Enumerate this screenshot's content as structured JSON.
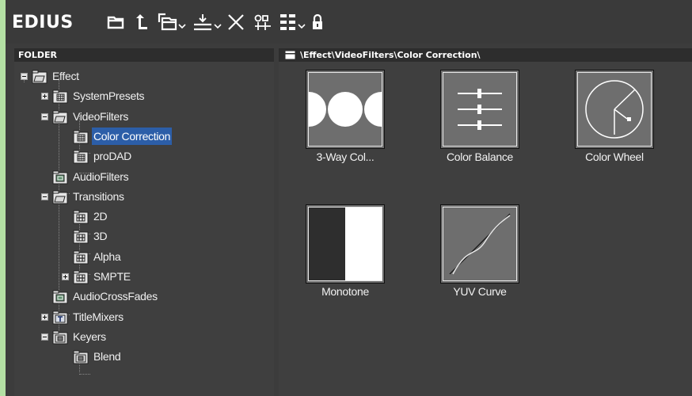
{
  "app": {
    "title": "EDIUS"
  },
  "toolbar": {
    "buttons": [
      {
        "name": "new-folder",
        "icon": "folder-icon"
      },
      {
        "name": "up-level",
        "icon": "up-arrow-icon"
      },
      {
        "name": "copy",
        "icon": "copy-icon"
      },
      {
        "name": "import",
        "icon": "import-icon"
      },
      {
        "name": "delete",
        "icon": "delete-icon"
      },
      {
        "name": "properties",
        "icon": "properties-icon"
      },
      {
        "name": "view",
        "icon": "view-list-icon"
      },
      {
        "name": "lock",
        "icon": "lock-icon"
      }
    ]
  },
  "folder_panel": {
    "title": "FOLDER",
    "tree": [
      {
        "label": "Effect",
        "expand": "minus"
      },
      {
        "label": "SystemPresets",
        "expand": "plus"
      },
      {
        "label": "VideoFilters",
        "expand": "minus"
      },
      {
        "label": "Color Correction",
        "selected": true
      },
      {
        "label": "proDAD"
      },
      {
        "label": "AudioFilters"
      },
      {
        "label": "Transitions",
        "expand": "minus"
      },
      {
        "label": "2D"
      },
      {
        "label": "3D"
      },
      {
        "label": "Alpha"
      },
      {
        "label": "SMPTE",
        "expand": "plus"
      },
      {
        "label": "AudioCrossFades"
      },
      {
        "label": "TitleMixers",
        "expand": "plus"
      },
      {
        "label": "Keyers",
        "expand": "minus"
      },
      {
        "label": "Blend"
      }
    ]
  },
  "content_panel": {
    "path": "\\Effect\\VideoFilters\\Color Correction\\",
    "items": [
      {
        "label": "3-Way Col...",
        "icon": "three-way-color-icon"
      },
      {
        "label": "Color Balance",
        "icon": "color-balance-icon"
      },
      {
        "label": "Color Wheel",
        "icon": "color-wheel-icon"
      },
      {
        "label": "Monotone",
        "icon": "monotone-icon"
      },
      {
        "label": "YUV Curve",
        "icon": "yuv-curve-icon"
      }
    ]
  }
}
